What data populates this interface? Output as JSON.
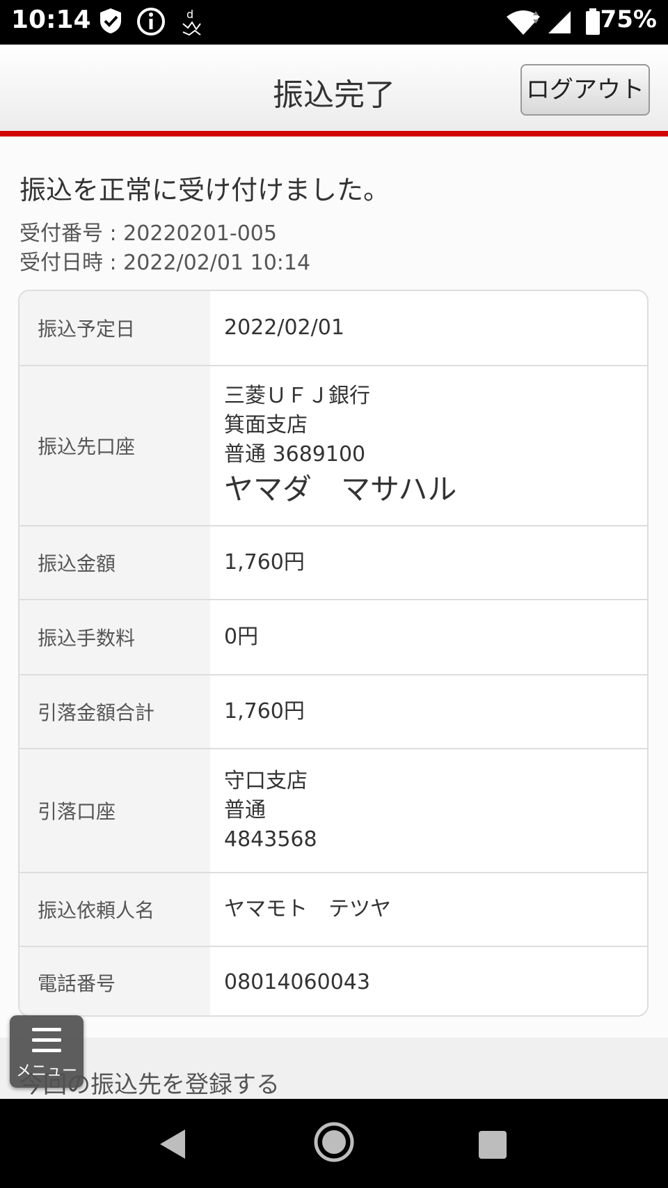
{
  "status_bar": {
    "time": "10:14",
    "battery": "75%",
    "icons": [
      "shield-icon",
      "info-icon",
      "d-health-icon",
      "wifi-icon",
      "signal-icon",
      "battery-icon"
    ]
  },
  "header": {
    "title": "振込完了",
    "logout_label": "ログアウト",
    "accent_color": "#d20000"
  },
  "result": {
    "message": "振込を正常に受け付けました。",
    "receipt_number": "受付番号 : 20220201-005",
    "receipt_datetime": "受付日時 : 2022/02/01 10:14"
  },
  "details": [
    {
      "label": "振込予定日",
      "lines": [
        "2022/02/01"
      ]
    },
    {
      "label": "振込先口座",
      "lines": [
        "三菱ＵＦＪ銀行",
        "箕面支店",
        "普通 3689100"
      ],
      "name": "ヤマダ　マサハル"
    },
    {
      "label": "振込金額",
      "lines": [
        "1,760円"
      ]
    },
    {
      "label": "振込手数料",
      "lines": [
        "0円"
      ]
    },
    {
      "label": "引落金額合計",
      "lines": [
        "1,760円"
      ]
    },
    {
      "label": "引落口座",
      "lines": [
        "守口支店",
        "普通",
        "4843568"
      ]
    },
    {
      "label": "振込依頼人名",
      "lines": [
        "ヤマモト　テツヤ"
      ]
    },
    {
      "label": "電話番号",
      "lines": [
        "08014060043"
      ]
    }
  ],
  "register_link": "今回の振込先を登録する",
  "menu_label": "メニュー",
  "nav": [
    "back-icon",
    "home-icon",
    "recents-icon"
  ]
}
